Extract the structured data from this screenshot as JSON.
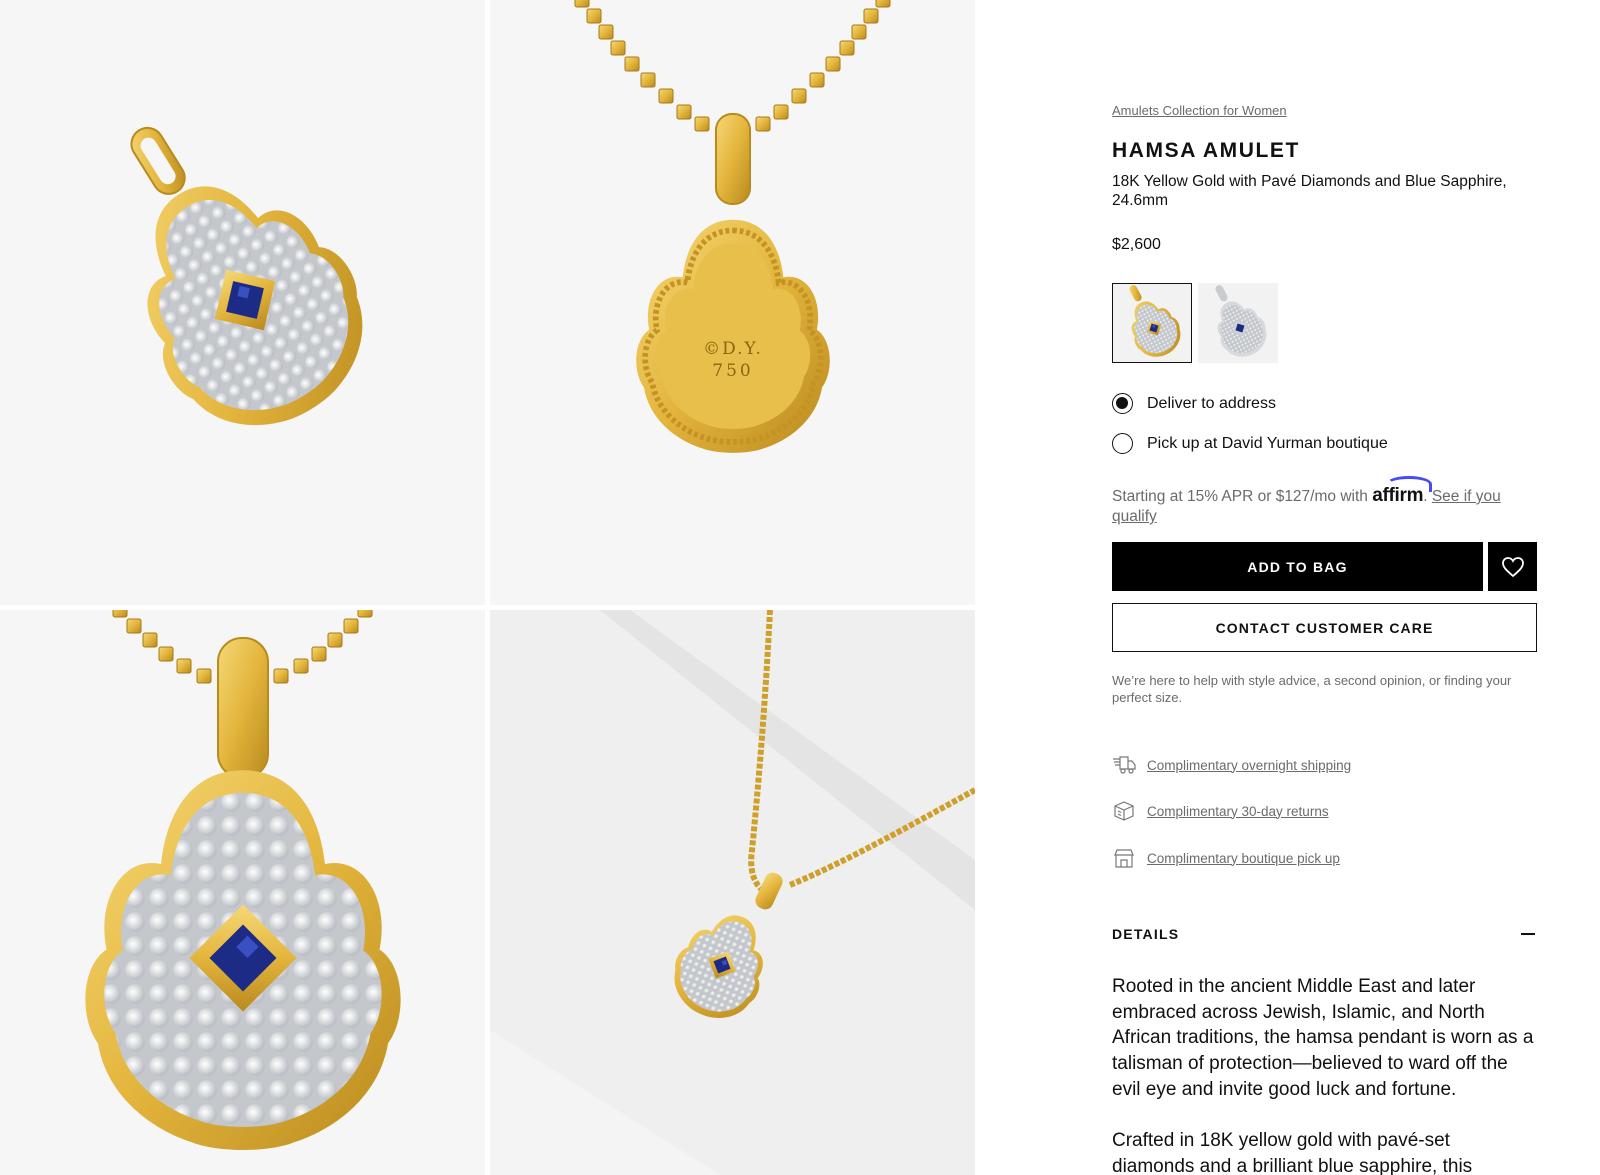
{
  "product": {
    "breadcrumb": "Amulets Collection for Women",
    "title": "HAMSA AMULET",
    "subtitle": "18K Yellow Gold with Pavé Diamonds and Blue Sapphire, 24.6mm",
    "price": "$2,600"
  },
  "gallery": {
    "engraving_line1": "©D.Y.",
    "engraving_line2": "750"
  },
  "swatches": [
    {
      "name": "Yellow Gold",
      "selected": true
    },
    {
      "name": "Sterling Silver",
      "selected": false
    }
  ],
  "delivery": {
    "option1": "Deliver to address",
    "option2": "Pick up at David Yurman boutique",
    "selected": "option1"
  },
  "financing": {
    "prefix": "Starting at 15% APR or $127/mo with",
    "brand": "affirm",
    "suffix": ".",
    "link": "See if you qualify"
  },
  "actions": {
    "add_to_bag": "ADD TO BAG",
    "contact": "CONTACT CUSTOMER CARE",
    "help_text": "We’re here to help with style advice, a second opinion, or finding your perfect size."
  },
  "perks": [
    {
      "label": "Complimentary overnight shipping",
      "icon": "truck-icon"
    },
    {
      "label": "Complimentary 30-day returns",
      "icon": "box-return-icon"
    },
    {
      "label": "Complimentary boutique pick up",
      "icon": "store-icon"
    }
  ],
  "details": {
    "heading": "DETAILS",
    "paragraph1": "Rooted in the ancient Middle East and later embraced across Jewish, Islamic, and North African traditions, the hamsa pendant is worn as a talisman of protection—believed to ward off the evil eye and invite good luck and fortune.",
    "paragraph2": "Crafted in 18K yellow gold with pavé-set diamonds and a brilliant blue sapphire, this"
  },
  "colors": {
    "gold": "#e3b53c",
    "gold_dark": "#b98a1e",
    "diamond": "#dfe1e4",
    "sapphire": "#1c2c86",
    "affirm_blue": "#4a4af4"
  }
}
